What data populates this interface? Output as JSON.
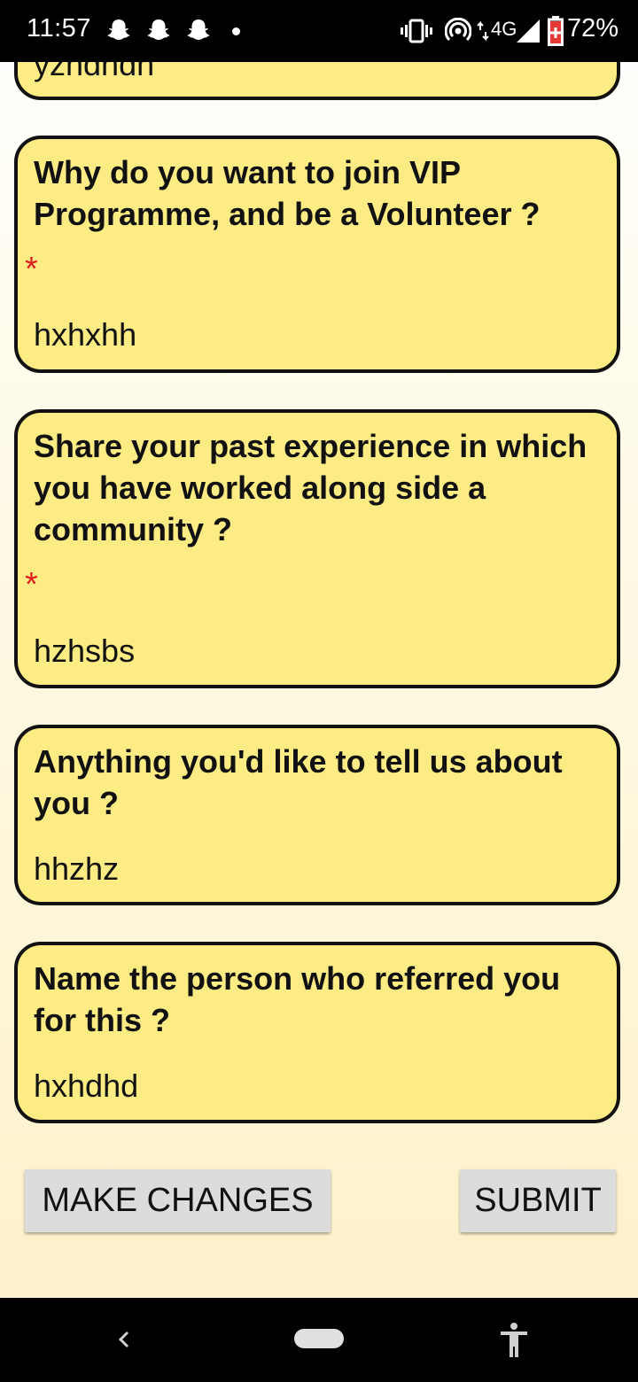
{
  "status_bar": {
    "time": "11:57",
    "network": "4G",
    "battery": "72%",
    "icons": [
      "snapchat-ghost-icon",
      "snapchat-ghost-icon",
      "snapchat-ghost-icon",
      "notification-dot",
      "vibrate-icon",
      "hotspot-icon",
      "data-arrows-icon",
      "signal-icon",
      "battery-icon"
    ]
  },
  "form": {
    "previous_answer_partial": "yzhdhdh",
    "questions": [
      {
        "label": "Why do you want to join VIP Programme, and be a Volunteer ?",
        "required": true,
        "required_mark": "*",
        "answer": "hxhxhh"
      },
      {
        "label": "Share your past experience in which you have worked along side a community ?",
        "required": true,
        "required_mark": "*",
        "answer": "hzhsbs"
      },
      {
        "label": "Anything you'd like to tell us about you ?",
        "required": false,
        "answer": "hhzhz"
      },
      {
        "label": "Name the person who referred you for this ?",
        "required": false,
        "answer": "hxhdhd"
      }
    ]
  },
  "actions": {
    "make_changes": "MAKE CHANGES",
    "submit": "SUBMIT"
  },
  "colors": {
    "card_background": "#fdeb83",
    "card_border": "#111111",
    "required": "#e02020",
    "button": "#dcdcdc"
  },
  "nav_bar": {
    "icons": [
      "back-icon",
      "home-pill-icon",
      "accessibility-icon"
    ]
  }
}
